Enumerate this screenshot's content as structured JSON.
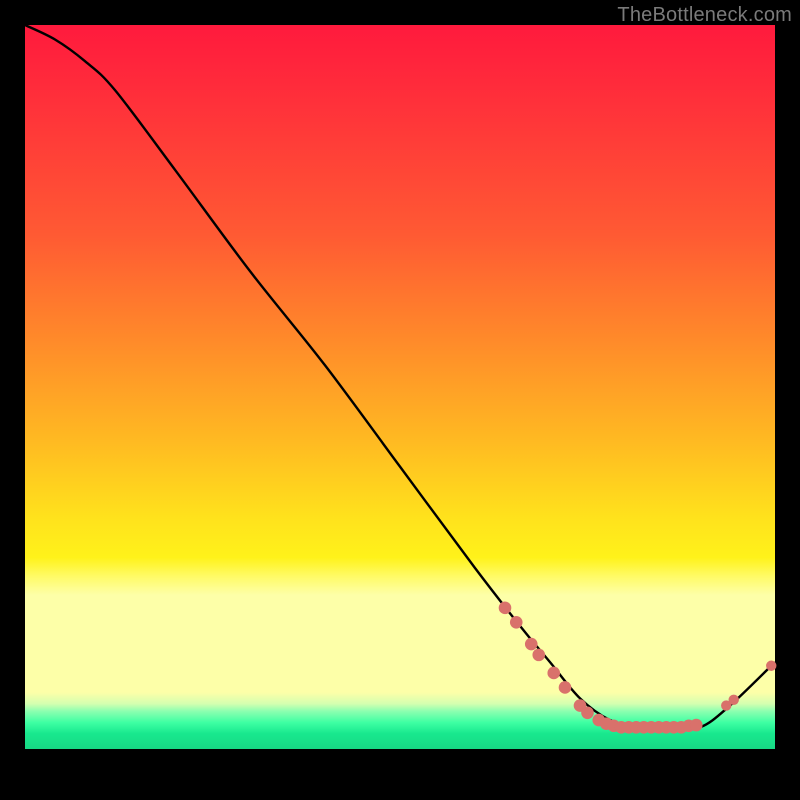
{
  "watermark": "TheBottleneck.com",
  "chart_data": {
    "type": "line",
    "title": "",
    "xlabel": "",
    "ylabel": "",
    "xlim": [
      0,
      100
    ],
    "ylim": [
      0,
      100
    ],
    "series": [
      {
        "name": "curve",
        "x": [
          0,
          4,
          8,
          12,
          20,
          30,
          40,
          50,
          60,
          66,
          70,
          74,
          78,
          82,
          86,
          90,
          94,
          100
        ],
        "y": [
          100,
          98,
          95,
          91,
          80,
          66,
          53,
          39,
          25,
          17,
          12,
          7,
          4,
          3,
          3,
          3,
          6,
          12
        ]
      }
    ],
    "markers": [
      {
        "x": 64.0,
        "y": 19.5
      },
      {
        "x": 65.5,
        "y": 17.5
      },
      {
        "x": 67.5,
        "y": 14.5
      },
      {
        "x": 68.5,
        "y": 13.0
      },
      {
        "x": 70.5,
        "y": 10.5
      },
      {
        "x": 72.0,
        "y": 8.5
      },
      {
        "x": 74.0,
        "y": 6.0
      },
      {
        "x": 75.0,
        "y": 5.0
      },
      {
        "x": 76.5,
        "y": 4.0
      },
      {
        "x": 77.5,
        "y": 3.5
      },
      {
        "x": 78.5,
        "y": 3.2
      },
      {
        "x": 79.5,
        "y": 3.0
      },
      {
        "x": 80.5,
        "y": 3.0
      },
      {
        "x": 81.5,
        "y": 3.0
      },
      {
        "x": 82.5,
        "y": 3.0
      },
      {
        "x": 83.5,
        "y": 3.0
      },
      {
        "x": 84.5,
        "y": 3.0
      },
      {
        "x": 85.5,
        "y": 3.0
      },
      {
        "x": 86.5,
        "y": 3.0
      },
      {
        "x": 87.5,
        "y": 3.0
      },
      {
        "x": 88.5,
        "y": 3.2
      },
      {
        "x": 89.5,
        "y": 3.3
      },
      {
        "x": 93.5,
        "y": 6.0
      },
      {
        "x": 94.5,
        "y": 6.8
      },
      {
        "x": 99.5,
        "y": 11.5
      }
    ],
    "marker_color": "#d9716b",
    "marker_loose": [
      22,
      23,
      24
    ],
    "line_color": "#000000"
  }
}
